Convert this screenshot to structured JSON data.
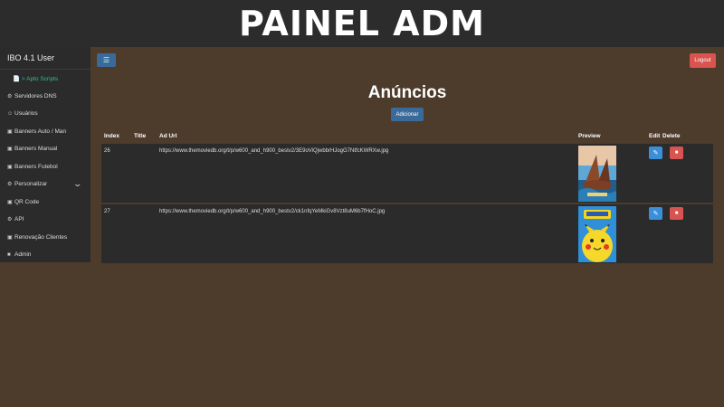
{
  "banner": {
    "title": "PAINEL ADM"
  },
  "sidebar": {
    "brand": "IBO 4.1 User",
    "items": [
      {
        "label": "📄 > Apto Scripts",
        "icon": "",
        "active": true
      },
      {
        "label": "Servidores DNS",
        "icon": "⚙"
      },
      {
        "label": "Usuários",
        "icon": "☺"
      },
      {
        "label": "Banners Auto / Man",
        "icon": "▣"
      },
      {
        "label": "Banners Manual",
        "icon": "▣"
      },
      {
        "label": "Banners Futebol",
        "icon": "▣"
      },
      {
        "label": "Personalizar",
        "icon": "⚙"
      },
      {
        "label": "QR Code",
        "icon": "▣"
      },
      {
        "label": "API",
        "icon": "⚙"
      },
      {
        "label": "Renovação Clientes",
        "icon": "▣"
      },
      {
        "label": "Admin",
        "icon": "■"
      }
    ]
  },
  "topbar": {
    "logout_label": "Logout"
  },
  "main": {
    "title": "Anúncios",
    "add_label": "Adicionar",
    "columns": {
      "index": "Index",
      "title": "Title",
      "ad_url": "Ad Url",
      "preview": "Preview",
      "edit": "Edit",
      "delete": "Delete"
    },
    "rows": [
      {
        "index": "26",
        "title": "",
        "ad_url": "https://www.themoviedb.org/t/p/w600_and_h900_bestv2/3E9oViQjwbbrHJogG7NtfcKWRXw.jpg"
      },
      {
        "index": "27",
        "title": "",
        "ad_url": "https://www.themoviedb.org/t/p/w600_and_h900_bestv2/ck1nfqYeMkiGv8Vzt8uM6b7fHoC.jpg"
      }
    ]
  },
  "colors": {
    "accent": "#3a6a9a",
    "danger": "#d9534f",
    "edit": "#3b8fd9",
    "background": "#4d3b2c",
    "panel": "#2b2b2b"
  }
}
